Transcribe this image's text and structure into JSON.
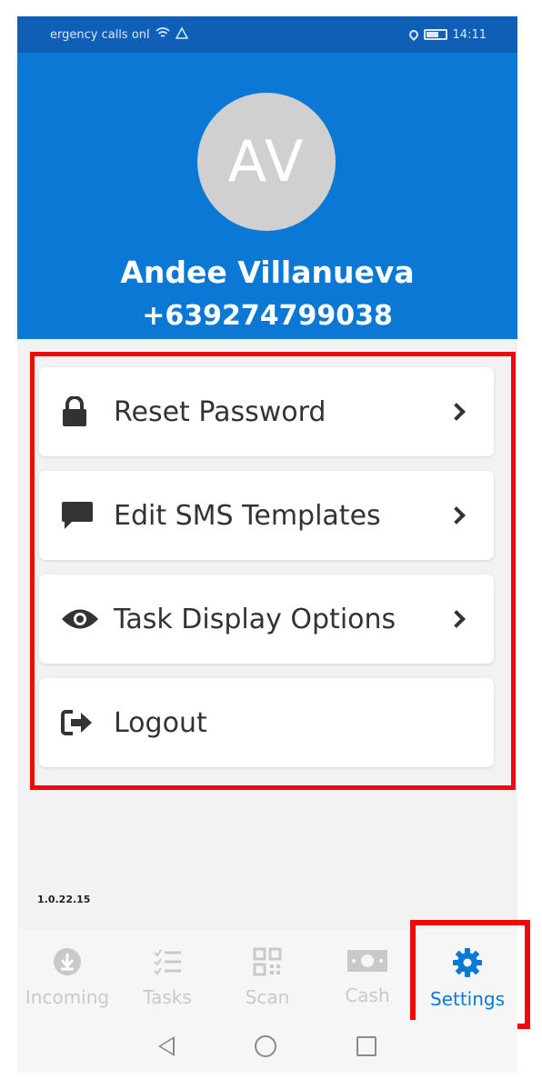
{
  "status_bar": {
    "left_text": "ergency calls onl",
    "time": "14:11"
  },
  "profile": {
    "initials": "AV",
    "name": "Andee Villanueva",
    "phone": "+639274799038"
  },
  "menu": [
    {
      "label": "Reset Password",
      "icon": "lock-icon",
      "has_chevron": true
    },
    {
      "label": "Edit SMS Templates",
      "icon": "message-icon",
      "has_chevron": true
    },
    {
      "label": "Task Display Options",
      "icon": "eye-icon",
      "has_chevron": true
    },
    {
      "label": "Logout",
      "icon": "logout-icon",
      "has_chevron": false
    }
  ],
  "version": "1.0.22.15",
  "tabs": [
    {
      "label": "Incoming",
      "icon": "download-icon",
      "active": false
    },
    {
      "label": "Tasks",
      "icon": "checklist-icon",
      "active": false
    },
    {
      "label": "Scan",
      "icon": "qr-code-icon",
      "active": false
    },
    {
      "label": "Cash",
      "icon": "cash-icon",
      "active": false
    },
    {
      "label": "Settings",
      "icon": "gear-icon",
      "active": true
    }
  ],
  "colors": {
    "header_blue": "#0b78d6",
    "status_blue": "#0f5fb7",
    "highlight_red": "#ee0a0a",
    "active_tab": "#0b78d6",
    "inactive_tab": "#c9c9c9"
  }
}
